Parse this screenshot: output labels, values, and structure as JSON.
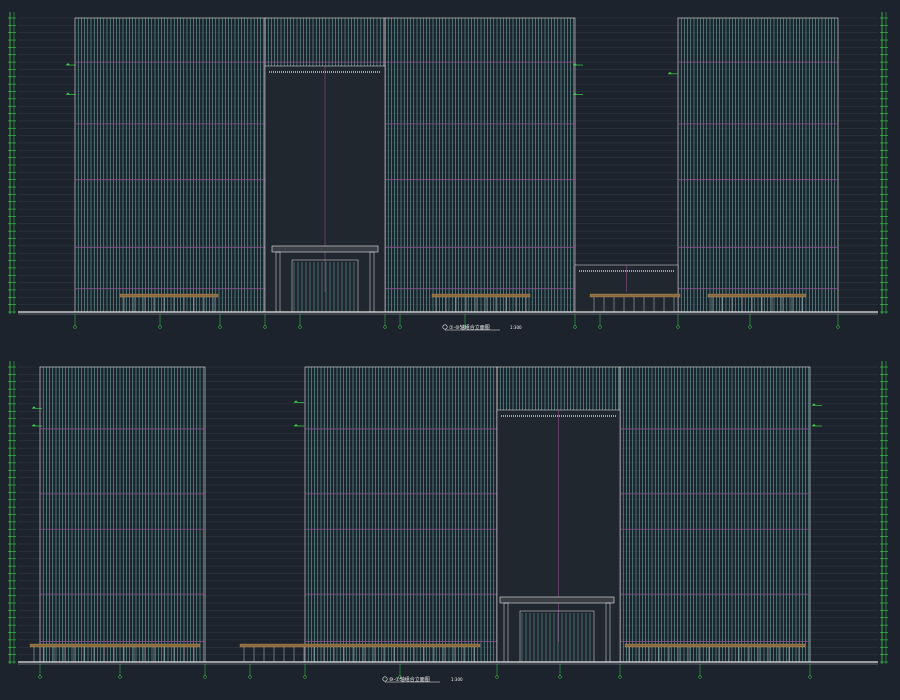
{
  "drawing": {
    "type": "cad-elevation-sheet",
    "colors": {
      "background": "#1c232c",
      "mullion": "#7fd6cf",
      "floor_line": "#8d4f8f",
      "level_line": "#5f6b78",
      "dimension": "#3fd14a",
      "outline": "#e8e8e8",
      "wood": "#8a6a3b",
      "title_text": "#f2f2f2"
    },
    "floors_per_elevation": 40,
    "elevations": [
      {
        "id": "elevation-top",
        "title": "①-⑩轴组合立面图",
        "scale": "1:300",
        "tower_count": 3,
        "podium_gates": 1
      },
      {
        "id": "elevation-bottom",
        "title": "⑩-①轴组合立面图",
        "scale": "1:300",
        "tower_count": 3,
        "podium_gates": 1
      }
    ]
  }
}
